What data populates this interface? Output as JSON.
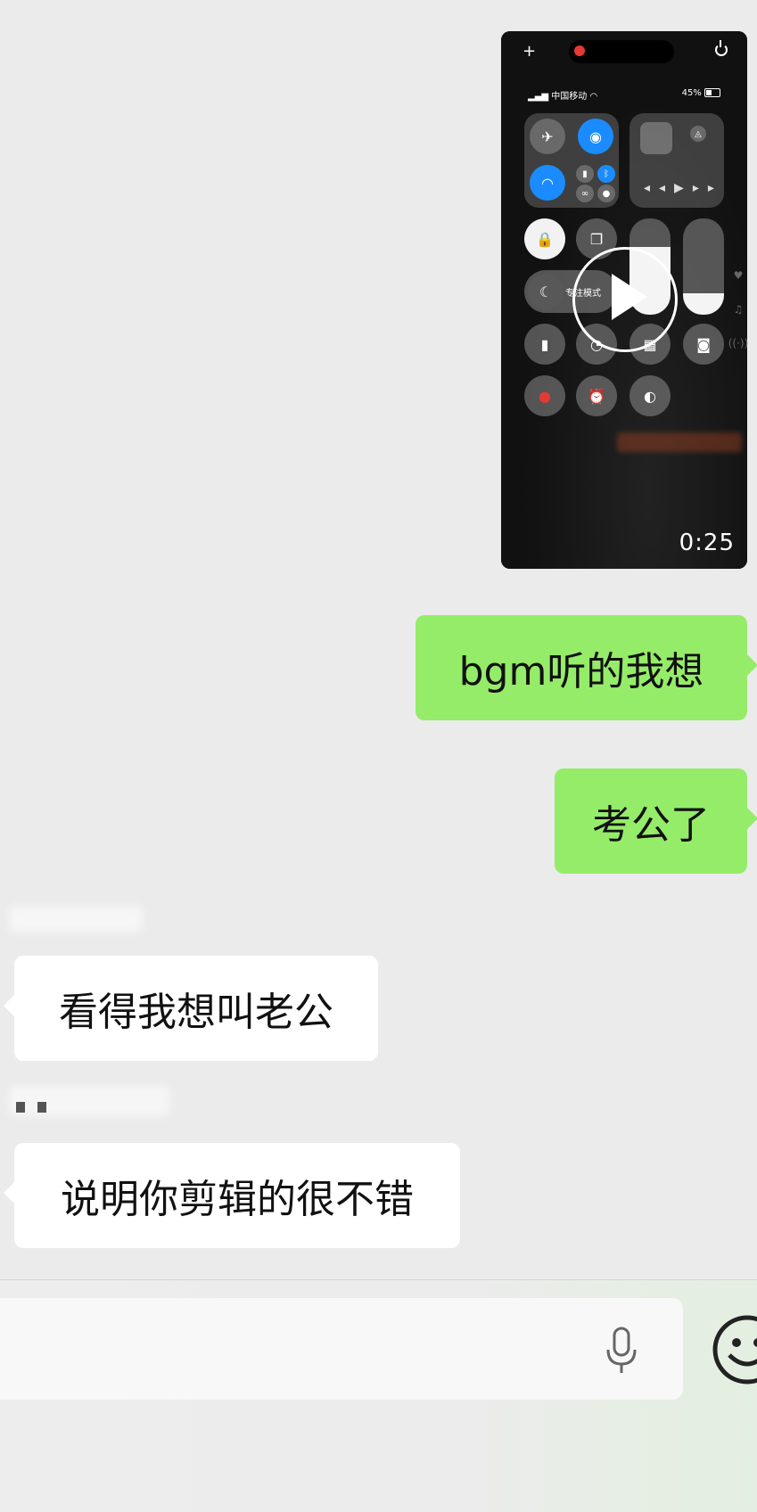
{
  "video_message": {
    "duration": "0:25",
    "preview": {
      "carrier": "中国移动",
      "battery": "45%",
      "focus_mode": "专注模式"
    }
  },
  "messages": [
    {
      "direction": "outgoing",
      "text": "bgm听的我想"
    },
    {
      "direction": "outgoing",
      "text": "考公了"
    },
    {
      "direction": "incoming",
      "text": "看得我想叫老公"
    },
    {
      "direction": "incoming",
      "text": "说明你剪辑的很不错"
    }
  ],
  "input_bar": {
    "mic_icon": "microphone-icon",
    "emoji_icon": "emoji-icon"
  },
  "colors": {
    "outgoing_bubble": "#95ec69",
    "incoming_bubble": "#ffffff",
    "background": "#ebebeb"
  }
}
